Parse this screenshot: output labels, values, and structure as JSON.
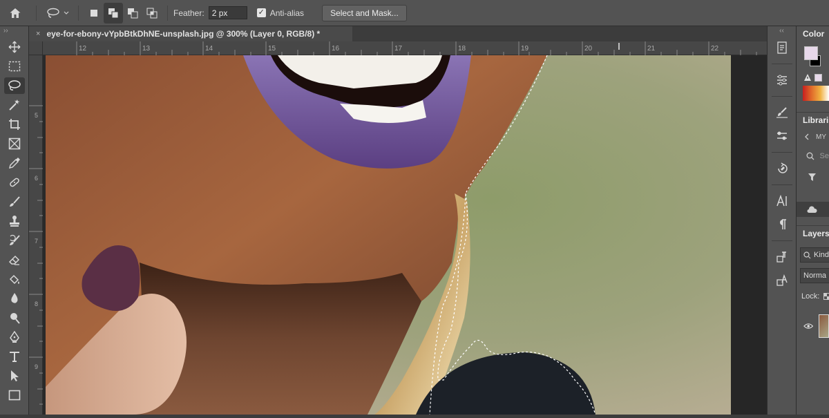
{
  "options": {
    "feather_label": "Feather:",
    "feather_value": "2 px",
    "anti_alias_label": "Anti-alias",
    "anti_alias_checked": true,
    "select_mask_label": "Select and Mask..."
  },
  "document": {
    "tab_title": "eye-for-ebony-vYpbBtkDhNE-unsplash.jpg @ 300% (Layer 0, RGB/8) *",
    "close_symbol": "×"
  },
  "rulers": {
    "top": [
      "12",
      "13",
      "14",
      "15",
      "16",
      "17",
      "18",
      "19",
      "20",
      "21",
      "22"
    ],
    "left": [
      "5",
      "6",
      "7",
      "8",
      "9"
    ]
  },
  "panels": {
    "color_title": "Color",
    "libraries_title": "Librari",
    "libraries_group": "MY",
    "search_placeholder": "Se",
    "layers_title": "Layers",
    "kind_label": "Kind",
    "blend_mode": "Norma",
    "lock_label": "Lock:"
  },
  "colors": {
    "foreground": "#e7d8ea",
    "background": "#000000",
    "accent": "#ececec"
  }
}
